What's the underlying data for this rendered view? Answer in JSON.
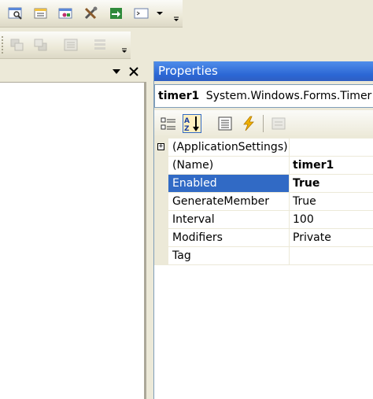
{
  "properties": {
    "title": "Properties",
    "object_name": "timer1",
    "object_type": "System.Windows.Forms.Timer",
    "toolbar": {
      "categorized": "categorized-icon",
      "alphabetical": "alphabetical-icon",
      "properties": "properties-icon",
      "events": "events-icon",
      "property_pages": "property-pages-icon"
    },
    "rows": [
      {
        "name": "(ApplicationSettings)",
        "value": "",
        "expandable": true
      },
      {
        "name": "(Name)",
        "value": "timer1",
        "bold": true
      },
      {
        "name": "Enabled",
        "value": "True",
        "bold": true,
        "selected": true
      },
      {
        "name": "GenerateMember",
        "value": "True"
      },
      {
        "name": "Interval",
        "value": "100"
      },
      {
        "name": "Modifiers",
        "value": "Private"
      },
      {
        "name": "Tag",
        "value": ""
      }
    ]
  },
  "colors": {
    "title_bar": "#2b66d4",
    "selection": "#316ac5",
    "chrome": "#ece9d8"
  }
}
